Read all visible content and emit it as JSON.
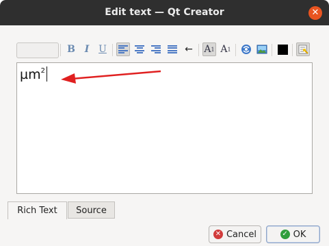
{
  "window": {
    "title": "Edit text — Qt Creator",
    "close_glyph": "✕"
  },
  "toolbar": {
    "font_size_value": "",
    "bold": "B",
    "italic": "I",
    "underline": "U",
    "link_direction": "←",
    "superscript_base": "A",
    "superscript_mark": "1",
    "subscript_base": "A",
    "subscript_mark": "1",
    "text_color": "#000000",
    "icons": [
      "font-size-combobox",
      "bold-icon",
      "italic-icon",
      "underline-icon",
      "align-left-icon",
      "align-center-icon",
      "align-right-icon",
      "align-justify-icon",
      "right-to-left-icon",
      "superscript-icon",
      "subscript-icon",
      "insert-link-icon",
      "insert-image-icon",
      "text-color-icon",
      "simplify-rich-text-icon"
    ]
  },
  "editor": {
    "text_base": "µm",
    "text_superscript": "2",
    "annotation_color": "#e02020"
  },
  "tabs": [
    {
      "label": "Rich Text",
      "selected": true
    },
    {
      "label": "Source",
      "selected": false
    }
  ],
  "buttons": {
    "cancel_label": "Cancel",
    "ok_label": "OK"
  }
}
